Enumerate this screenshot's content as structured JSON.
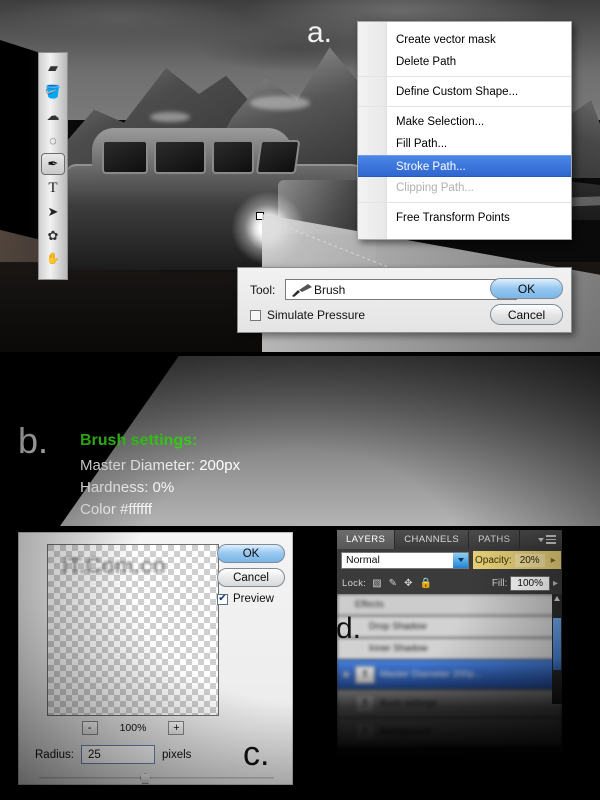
{
  "labels": {
    "a": "a.",
    "b": "b.",
    "c": "c.",
    "d": "d."
  },
  "context_menu": {
    "items": [
      {
        "label": "Create vector mask",
        "state": "normal"
      },
      {
        "label": "Delete Path",
        "state": "normal"
      },
      {
        "label": "Define Custom Shape...",
        "state": "normal"
      },
      {
        "label": "Make Selection...",
        "state": "normal"
      },
      {
        "label": "Fill Path...",
        "state": "normal"
      },
      {
        "label": "Stroke Path...",
        "state": "selected"
      },
      {
        "label": "Clipping Path...",
        "state": "disabled"
      },
      {
        "label": "Free Transform Points",
        "state": "normal"
      }
    ],
    "highlight_color": "#3c70d8"
  },
  "stroke_dialog": {
    "tool_label": "Tool:",
    "tool_value": "Brush",
    "tool_icon": "brush-icon",
    "simulate_pressure_label": "Simulate Pressure",
    "simulate_pressure_checked": false,
    "ok_label": "OK",
    "cancel_label": "Cancel"
  },
  "brush_settings": {
    "heading": "Brush settings:",
    "heading_color": "#3fe31b",
    "lines": [
      "Master Diameter: 200px",
      "Hardness: 0%",
      "Color #ffffff"
    ]
  },
  "blur_dialog": {
    "ok_label": "OK",
    "cancel_label": "Cancel",
    "preview_label": "Preview",
    "preview_checked": true,
    "preview_check_glyph": "✔",
    "watermark": "iT.Com.cn",
    "zoom_out_label": "-",
    "zoom_in_label": "+",
    "zoom_value": "100%",
    "radius_label": "Radius:",
    "radius_value": "25",
    "radius_units": "pixels",
    "radius_slider_percent": 45
  },
  "layers_panel": {
    "tabs": [
      {
        "label": "LAYERS",
        "active": true
      },
      {
        "label": "CHANNELS",
        "active": false
      },
      {
        "label": "PATHS",
        "active": false
      }
    ],
    "menu_icon": "panel-menu-icon",
    "blend_mode": "Normal",
    "opacity_label": "Opacity:",
    "opacity_value": "20%",
    "opacity_arrow": "▸",
    "lock_label": "Lock:",
    "lock_icons": [
      "transparency-lock-icon",
      "brush-lock-icon",
      "move-lock-icon",
      "all-lock-icon"
    ],
    "lock_glyphs": [
      "▨",
      "✎",
      "✥",
      "🔒"
    ],
    "fill_label": "Fill:",
    "fill_value": "100%",
    "fill_arrow": "▸",
    "rows": [
      {
        "name": "Effects",
        "type": "effects",
        "eye": "◉"
      },
      {
        "name": "Drop Shadow",
        "type": "sub-effect",
        "eye": "◉"
      },
      {
        "name": "Inner Shadow",
        "type": "sub-effect",
        "eye": "◉"
      },
      {
        "name": "Master Diameter 200p...",
        "type": "selected",
        "eye": "◉"
      },
      {
        "name": "Bush settings",
        "type": "normal",
        "eye": "◉"
      },
      {
        "name": "Background",
        "type": "normal",
        "eye": "◉"
      }
    ]
  }
}
